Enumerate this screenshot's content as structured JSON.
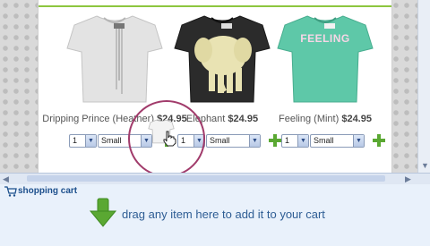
{
  "products": [
    {
      "name": "Dripping Prince (Heather)",
      "price": "$24.95",
      "qty": "1",
      "size": "Small",
      "shirt_color": "#e3e3e3"
    },
    {
      "name": "Elephant",
      "price": "$24.95",
      "qty": "1",
      "size": "Small",
      "shirt_color": "#2b2b2b"
    },
    {
      "name": "Feeling (Mint)",
      "price": "$24.95",
      "qty": "1",
      "size": "Small",
      "shirt_color": "#5ec8a8",
      "print_text": "FEELING"
    }
  ],
  "cart": {
    "title": "shopping cart",
    "drop_hint": "drag any item here to add it to your cart"
  },
  "colors": {
    "accent_green": "#5aa832",
    "cart_background": "#e9f1fb",
    "cart_title": "#1c4f8c",
    "highlight_circle": "#a13b6b"
  },
  "icons": [
    "cart-icon",
    "plus-icon",
    "down-arrow-icon",
    "hand-cursor-icon"
  ]
}
